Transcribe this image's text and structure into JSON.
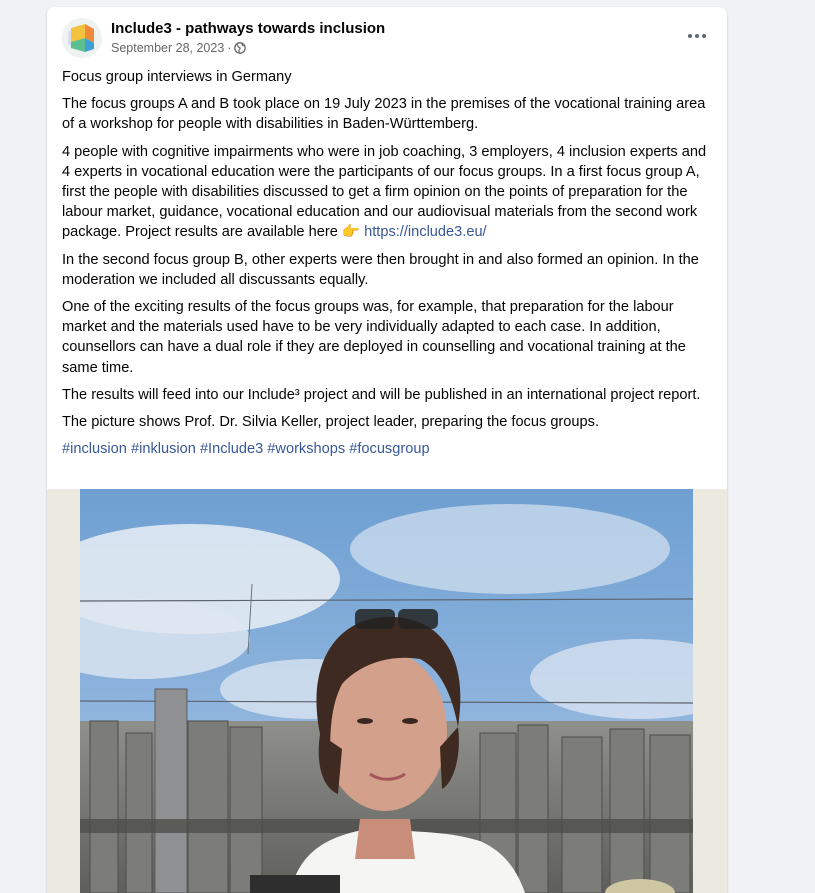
{
  "post": {
    "page_name": "Include3 - pathways towards inclusion",
    "date": "September 28, 2023",
    "separator": "·",
    "paragraphs": {
      "p1": "Focus group interviews in Germany",
      "p2": "The focus groups A and B took place on 19 July 2023 in the premises of the vocational training area of a workshop for people with disabilities in Baden-Württemberg.",
      "p3": "4 people with cognitive impairments who were in job coaching, 3 employers, 4 inclusion experts and 4 experts in vocational education were the participants of our focus groups. In a first focus group A, first the people with disabilities discussed to get a firm opinion on the points of preparation for the labour market, guidance, vocational education and our audiovisual materials from the second work package. Project results are available here 👉",
      "p3_link": "https://include3.eu/",
      "p4": "In the second focus group B, other experts were then brought in and also formed an opinion. In the moderation we included all discussants equally.",
      "p5": "One of the exciting results of the focus groups was, for example, that preparation for the labour market and the materials used have to be very individually adapted to each case. In addition, counsellors can have a dual role if they are deployed in counselling and vocational training at the same time.",
      "p6": "The results will feed into our Include³ project and will be published in an international project report.",
      "p7": "The picture shows Prof. Dr. Silvia Keller, project leader, preparing the focus groups."
    },
    "hashtags": [
      "#inclusion",
      "#inklusion",
      "#Include3",
      "#workshops",
      "#focusgroup"
    ]
  },
  "icons": {
    "avatar": "include3-logo",
    "visibility": "globe-icon",
    "menu": "more-options-icon"
  },
  "colors": {
    "link": "#385898",
    "secondary_text": "#65676b",
    "background": "#f0f2f5"
  }
}
